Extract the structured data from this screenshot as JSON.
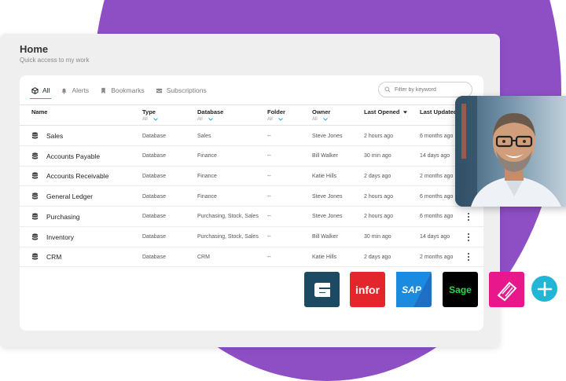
{
  "header": {
    "title": "Home",
    "subtitle": "Quick access to my work"
  },
  "tabs": [
    {
      "label": "All",
      "icon": "cube-icon",
      "active": true
    },
    {
      "label": "Alerts",
      "icon": "bell-icon",
      "active": false
    },
    {
      "label": "Bookmarks",
      "icon": "bookmark-icon",
      "active": false
    },
    {
      "label": "Subscriptions",
      "icon": "inbox-icon",
      "active": false
    }
  ],
  "search": {
    "placeholder": "Filter by keyword"
  },
  "columns": {
    "name": "Name",
    "type": "Type",
    "type_filter": "All",
    "database": "Database",
    "database_filter": "All",
    "folder": "Folder",
    "folder_filter": "All",
    "owner": "Owner",
    "owner_filter": "All",
    "last_opened": "Last Opened",
    "last_updated": "Last Updated"
  },
  "rows": [
    {
      "name": "Sales",
      "type": "Database",
      "database": "Sales",
      "folder": "--",
      "owner": "Steve Jones",
      "last_opened": "2 hours ago",
      "last_updated": "6 months ago"
    },
    {
      "name": "Accounts Payable",
      "type": "Database",
      "database": "Finance",
      "folder": "--",
      "owner": "Bill Walker",
      "last_opened": "30 min ago",
      "last_updated": "14 days ago"
    },
    {
      "name": "Accounts Receivable",
      "type": "Database",
      "database": "Finance",
      "folder": "--",
      "owner": "Katie Hills",
      "last_opened": "2 days ago",
      "last_updated": "2 months ago"
    },
    {
      "name": "General Ledger",
      "type": "Database",
      "database": "Finance",
      "folder": "--",
      "owner": "Steve Jones",
      "last_opened": "2 hours ago",
      "last_updated": "6 months ago"
    },
    {
      "name": "Purchasing",
      "type": "Database",
      "database": "Purchasing, Stock, Sales",
      "folder": "--",
      "owner": "Steve Jones",
      "last_opened": "2 hours ago",
      "last_updated": "6 months ago"
    },
    {
      "name": "Inventory",
      "type": "Database",
      "database": "Purchasing, Stock, Sales",
      "folder": "--",
      "owner": "Bill Walker",
      "last_opened": "30 min ago",
      "last_updated": "14 days ago"
    },
    {
      "name": "CRM",
      "type": "Database",
      "database": "CRM",
      "folder": "--",
      "owner": "Katie Hills",
      "last_opened": "2 days ago",
      "last_updated": "2 months ago"
    }
  ],
  "integrations": [
    {
      "name": "epicor",
      "color": "#1c4a63",
      "text": ""
    },
    {
      "name": "infor",
      "color": "#e4252b",
      "text": "infor"
    },
    {
      "name": "sap",
      "color": "#1e6fc5",
      "text": "SAP"
    },
    {
      "name": "sage",
      "color": "#000000",
      "text": "Sage"
    },
    {
      "name": "acumatica",
      "color": "#e8188c",
      "text": ""
    }
  ],
  "colors": {
    "accent": "#2aa8d8",
    "purple": "#8e4fc4",
    "plus": "#23b5d6"
  }
}
